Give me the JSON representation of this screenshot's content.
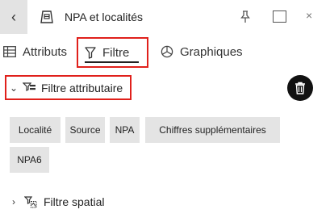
{
  "window": {
    "title": "NPA et localités",
    "back_glyph": "‹",
    "close_glyph": "×"
  },
  "tabs": [
    {
      "label": "Attributs",
      "icon": "table-icon"
    },
    {
      "label": "Filtre",
      "icon": "funnel-icon",
      "selected": true
    },
    {
      "label": "Graphiques",
      "icon": "pie-chart-icon"
    }
  ],
  "attribute_filter": {
    "label": "Filtre attributaire",
    "expanded": true,
    "chevron": "⌄",
    "icon": "attribute-filter-icon",
    "delete_icon": "trash-icon",
    "fields": [
      "Localité",
      "Source",
      "NPA",
      "Chiffres supplémentaires",
      "NPA6"
    ]
  },
  "spatial_filter": {
    "label": "Filtre spatial",
    "expanded": false,
    "chevron": "›",
    "icon": "spatial-filter-icon"
  },
  "colors": {
    "highlight_border": "#e0201b",
    "chip_bg": "#e4e4e4",
    "back_button_bg": "#e3e3e3",
    "delete_button_bg": "#111111"
  }
}
